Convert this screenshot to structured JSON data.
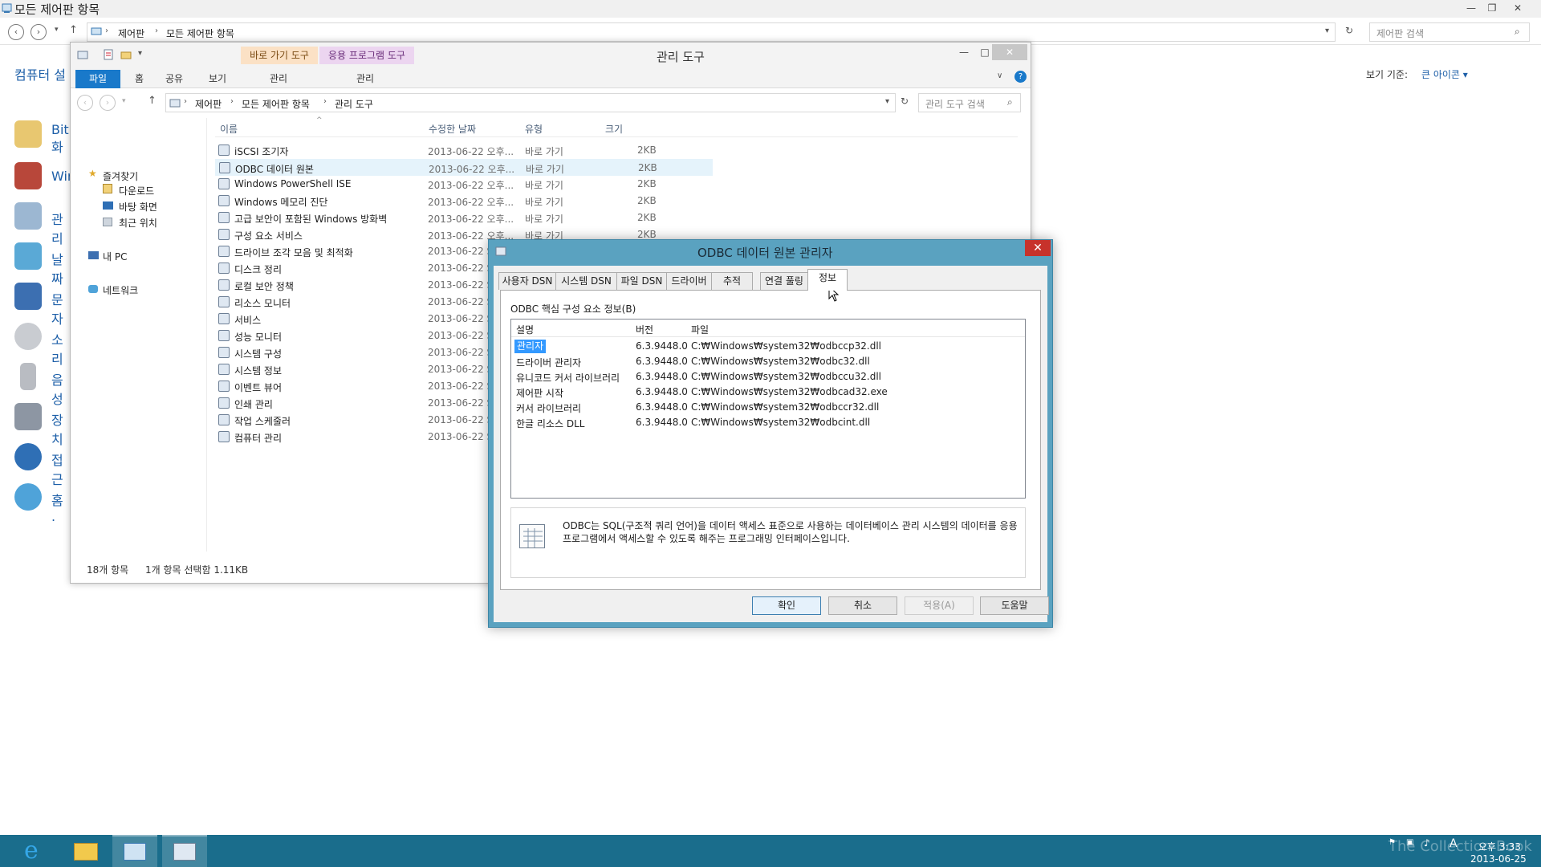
{
  "control_panel": {
    "title": "모든 제어판 항목",
    "breadcrumb": [
      "제어판",
      "모든 제어판 항목"
    ],
    "search_placeholder": "제어판 검색",
    "left_title": "컴퓨터 설",
    "view_by_label": "보기 기준:",
    "view_by_value": "큰 아이콘 ▾",
    "items": [
      {
        "label": "BitL",
        "label2": "화"
      },
      {
        "label": "Wir"
      },
      {
        "label": "관리"
      },
      {
        "label": "날짜"
      },
      {
        "label": "문자"
      },
      {
        "label": "소리"
      },
      {
        "label": "음성"
      },
      {
        "label": "장치"
      },
      {
        "label": "접근"
      },
      {
        "label": "홈 ."
      }
    ]
  },
  "explorer": {
    "title": "관리 도구",
    "context_tabs": [
      "바로 가기 도구",
      "응용 프로그램 도구"
    ],
    "ribbon_tabs": {
      "file": "파일",
      "home": "홈",
      "share": "공유",
      "view": "보기",
      "manage1": "관리",
      "manage2": "관리"
    },
    "breadcrumb": [
      "제어판",
      "모든 제어판 항목",
      "관리 도구"
    ],
    "search_placeholder": "관리 도구 검색",
    "nav": {
      "favorites": "즐겨찾기",
      "downloads": "다운로드",
      "desktop": "바탕 화면",
      "recent": "최근 위치",
      "this_pc": "내 PC",
      "network": "네트워크"
    },
    "columns": {
      "name": "이름",
      "date": "수정한 날짜",
      "type": "유형",
      "size": "크기"
    },
    "files": [
      {
        "name": "iSCSI 조기자",
        "date": "2013-06-22 오후...",
        "type": "바로 가기",
        "size": "2KB"
      },
      {
        "name": "ODBC 데이터 원본",
        "date": "2013-06-22 오후...",
        "type": "바로 가기",
        "size": "2KB"
      },
      {
        "name": "Windows PowerShell ISE",
        "date": "2013-06-22 오후...",
        "type": "바로 가기",
        "size": "2KB"
      },
      {
        "name": "Windows 메모리 진단",
        "date": "2013-06-22 오후...",
        "type": "바로 가기",
        "size": "2KB"
      },
      {
        "name": "고급 보안이 포함된 Windows 방화벽",
        "date": "2013-06-22 오후...",
        "type": "바로 가기",
        "size": "2KB"
      },
      {
        "name": "구성 요소 서비스",
        "date": "2013-06-22 오후...",
        "type": "바로 가기",
        "size": "2KB"
      },
      {
        "name": "드라이브 조각 모음 및 최적화",
        "date": "2013-06-22 S",
        "type": "",
        "size": ""
      },
      {
        "name": "디스크 정리",
        "date": "2013-06-22 S",
        "type": "",
        "size": ""
      },
      {
        "name": "로컬 보안 정책",
        "date": "2013-06-22 S",
        "type": "",
        "size": ""
      },
      {
        "name": "리소스 모니터",
        "date": "2013-06-22 S",
        "type": "",
        "size": ""
      },
      {
        "name": "서비스",
        "date": "2013-06-22 S",
        "type": "",
        "size": ""
      },
      {
        "name": "성능 모니터",
        "date": "2013-06-22 S",
        "type": "",
        "size": ""
      },
      {
        "name": "시스템 구성",
        "date": "2013-06-22 S",
        "type": "",
        "size": ""
      },
      {
        "name": "시스템 정보",
        "date": "2013-06-22 S",
        "type": "",
        "size": ""
      },
      {
        "name": "이벤트 뷰어",
        "date": "2013-06-22 S",
        "type": "",
        "size": ""
      },
      {
        "name": "인쇄 관리",
        "date": "2013-06-22 S",
        "type": "",
        "size": ""
      },
      {
        "name": "작업 스케줄러",
        "date": "2013-06-22 S",
        "type": "",
        "size": ""
      },
      {
        "name": "컴퓨터 관리",
        "date": "2013-06-22 S",
        "type": "",
        "size": ""
      }
    ],
    "status_count": "18개 항목",
    "status_selected": "1개 항목 선택함 1.11KB"
  },
  "dialog": {
    "title": "ODBC 데이터 원본 관리자",
    "tabs": [
      "사용자 DSN",
      "시스템 DSN",
      "파일 DSN",
      "드라이버",
      "추적",
      "연결 풀링",
      "정보"
    ],
    "active_tab": "정보",
    "group_label": "ODBC 핵심 구성 요소 정보(B)",
    "list_headers": {
      "desc": "설명",
      "version": "버전",
      "file": "파일"
    },
    "rows": [
      {
        "desc": "관리자",
        "version": "6.3.9448.0",
        "file": "C:₩Windows₩system32₩odbccp32.dll"
      },
      {
        "desc": "드라이버 관리자",
        "version": "6.3.9448.0",
        "file": "C:₩Windows₩system32₩odbc32.dll"
      },
      {
        "desc": "유니코드 커서 라이브러리",
        "version": "6.3.9448.0",
        "file": "C:₩Windows₩system32₩odbccu32.dll"
      },
      {
        "desc": "제어판 시작",
        "version": "6.3.9448.0",
        "file": "C:₩Windows₩system32₩odbcad32.exe"
      },
      {
        "desc": "커서 라이브러리",
        "version": "6.3.9448.0",
        "file": "C:₩Windows₩system32₩odbccr32.dll"
      },
      {
        "desc": "한글 리소스 DLL",
        "version": "6.3.9448.0",
        "file": "C:₩Windows₩system32₩odbcint.dll"
      }
    ],
    "info_text": "ODBC는 SQL(구조적 쿼리 언어)을 데이터 액세스 표준으로 사용하는 데이터베이스 관리 시스템의 데이터를 응용 프로그램에서 액세스할 수 있도록 해주는 프로그래밍 인터페이스입니다.",
    "buttons": {
      "ok": "확인",
      "cancel": "취소",
      "apply": "적용(A)",
      "help": "도움말"
    }
  },
  "taskbar": {
    "time": "오후 3:33",
    "date": "2013-06-25",
    "watermark": "The Collection Book"
  },
  "colors": {
    "accent": "#1979ca",
    "dialog_frame": "#5aa2c0",
    "taskbar": "#1a6d8c",
    "selection": "#3399ff"
  }
}
